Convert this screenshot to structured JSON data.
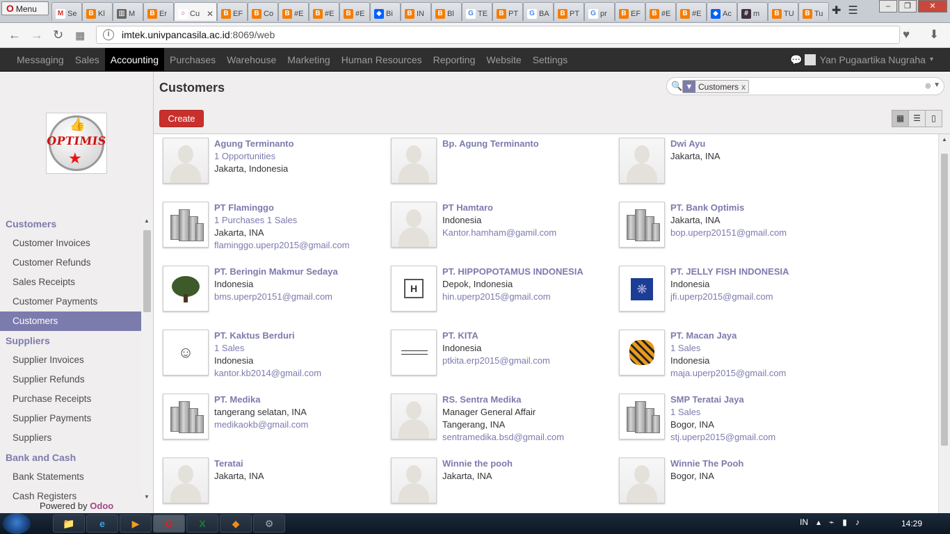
{
  "browser": {
    "menu_label": "Menu",
    "tabs": [
      {
        "label": "Se",
        "color": "#ffffff",
        "glyph": "M",
        "gcolor": "#d93025"
      },
      {
        "label": "Kl",
        "color": "#f57d00",
        "glyph": "B",
        "gcolor": "#fff"
      },
      {
        "label": "M",
        "color": "#666",
        "glyph": "▥",
        "gcolor": "#fff"
      },
      {
        "label": "Er",
        "color": "#f57d00",
        "glyph": "B",
        "gcolor": "#fff"
      },
      {
        "label": "Cu",
        "color": "#ffffff",
        "glyph": "○",
        "gcolor": "#8f3a8a"
      },
      {
        "label": "EF",
        "color": "#f57d00",
        "glyph": "B",
        "gcolor": "#fff"
      },
      {
        "label": "Co",
        "color": "#f57d00",
        "glyph": "B",
        "gcolor": "#fff"
      },
      {
        "label": "#E",
        "color": "#f57d00",
        "glyph": "B",
        "gcolor": "#fff"
      },
      {
        "label": "#E",
        "color": "#f57d00",
        "glyph": "B",
        "gcolor": "#fff"
      },
      {
        "label": "#E",
        "color": "#f57d00",
        "glyph": "B",
        "gcolor": "#fff"
      },
      {
        "label": "Bi",
        "color": "#0061fe",
        "glyph": "◆",
        "gcolor": "#fff"
      },
      {
        "label": "IN",
        "color": "#f57d00",
        "glyph": "B",
        "gcolor": "#fff"
      },
      {
        "label": "Bl",
        "color": "#f57d00",
        "glyph": "B",
        "gcolor": "#fff"
      },
      {
        "label": "TE",
        "color": "#ffffff",
        "glyph": "G",
        "gcolor": "#4285f4"
      },
      {
        "label": "PT",
        "color": "#f57d00",
        "glyph": "B",
        "gcolor": "#fff"
      },
      {
        "label": "BA",
        "color": "#ffffff",
        "glyph": "G",
        "gcolor": "#4285f4"
      },
      {
        "label": "PT",
        "color": "#f57d00",
        "glyph": "B",
        "gcolor": "#fff"
      },
      {
        "label": "pr",
        "color": "#ffffff",
        "glyph": "G",
        "gcolor": "#4285f4"
      },
      {
        "label": "EF",
        "color": "#f57d00",
        "glyph": "B",
        "gcolor": "#fff"
      },
      {
        "label": "#E",
        "color": "#f57d00",
        "glyph": "B",
        "gcolor": "#fff"
      },
      {
        "label": "#E",
        "color": "#f57d00",
        "glyph": "B",
        "gcolor": "#fff"
      },
      {
        "label": "Ac",
        "color": "#0061fe",
        "glyph": "◆",
        "gcolor": "#fff"
      },
      {
        "label": "m",
        "color": "#3e313c",
        "glyph": "#",
        "gcolor": "#fff"
      },
      {
        "label": "TU",
        "color": "#f57d00",
        "glyph": "B",
        "gcolor": "#fff"
      },
      {
        "label": "Tu",
        "color": "#f57d00",
        "glyph": "B",
        "gcolor": "#fff"
      }
    ],
    "active_tab_index": 4,
    "url_host": "imtek.univpancasila.ac.id",
    "url_rest": ":8069/web"
  },
  "topnav": {
    "items": [
      "Messaging",
      "Sales",
      "Accounting",
      "Purchases",
      "Warehouse",
      "Marketing",
      "Human Resources",
      "Reporting",
      "Website",
      "Settings"
    ],
    "active": "Accounting",
    "user_name": "Yan Pugaartika Nugraha"
  },
  "sidebar": {
    "logo_text": "OPTIMIS",
    "sections": [
      {
        "title": "Customers",
        "items": [
          "Customer Invoices",
          "Customer Refunds",
          "Sales Receipts",
          "Customer Payments",
          "Customers"
        ]
      },
      {
        "title": "Suppliers",
        "items": [
          "Supplier Invoices",
          "Supplier Refunds",
          "Purchase Receipts",
          "Supplier Payments",
          "Suppliers"
        ]
      },
      {
        "title": "Bank and Cash",
        "items": [
          "Bank Statements",
          "Cash Registers"
        ]
      }
    ],
    "active_item": "Customers",
    "powered_by": "Powered by",
    "powered_brand": "Odoo"
  },
  "control": {
    "title": "Customers",
    "create_label": "Create",
    "search_facet": "Customers"
  },
  "customers": [
    {
      "name": "Agung Terminanto",
      "img": "person",
      "lines": [
        {
          "t": "1 Opportunities",
          "k": "link"
        },
        {
          "t": "Jakarta, Indonesia",
          "k": "text"
        }
      ]
    },
    {
      "name": "Bp. Agung Terminanto",
      "img": "person",
      "lines": []
    },
    {
      "name": "Dwi Ayu",
      "img": "person",
      "lines": [
        {
          "t": "Jakarta, INA",
          "k": "text"
        }
      ]
    },
    {
      "name": "PT Flaminggo",
      "img": "building",
      "lines": [
        {
          "t": "1 Purchases 1 Sales",
          "k": "link"
        },
        {
          "t": "Jakarta, INA",
          "k": "text"
        },
        {
          "t": "flaminggo.uperp2015@gmail.com",
          "k": "email"
        }
      ]
    },
    {
      "name": "PT Hamtaro",
      "img": "person",
      "lines": [
        {
          "t": "Indonesia",
          "k": "text"
        },
        {
          "t": "Kantor.hamham@gamil.com",
          "k": "email"
        }
      ]
    },
    {
      "name": "PT. Bank Optimis",
      "img": "building",
      "lines": [
        {
          "t": "Jakarta, INA",
          "k": "text"
        },
        {
          "t": "bop.uperp20151@gmail.com",
          "k": "email"
        }
      ]
    },
    {
      "name": "PT. Beringin Makmur Sedaya",
      "img": "tree",
      "lines": [
        {
          "t": "Indonesia",
          "k": "text"
        },
        {
          "t": "bms.uperp20151@gmail.com",
          "k": "email"
        }
      ]
    },
    {
      "name": "PT. HIPPOPOTAMUS INDONESIA",
      "img": "hippo",
      "lines": [
        {
          "t": "Depok, Indonesia",
          "k": "text"
        },
        {
          "t": "hin.uperp2015@gmail.com",
          "k": "email"
        }
      ]
    },
    {
      "name": "PT. JELLY FISH INDONESIA",
      "img": "jelly",
      "lines": [
        {
          "t": "Indonesia",
          "k": "text"
        },
        {
          "t": "jfi.uperp2015@gmail.com",
          "k": "email"
        }
      ]
    },
    {
      "name": "PT. Kaktus Berduri",
      "img": "kaktus",
      "lines": [
        {
          "t": "1 Sales",
          "k": "link"
        },
        {
          "t": "Indonesia",
          "k": "text"
        },
        {
          "t": "kantor.kb2014@gmail.com",
          "k": "email"
        }
      ]
    },
    {
      "name": "PT. KITA",
      "img": "kita",
      "lines": [
        {
          "t": "Indonesia",
          "k": "text"
        },
        {
          "t": "ptkita.erp2015@gmail.com",
          "k": "email"
        }
      ]
    },
    {
      "name": "PT. Macan Jaya",
      "img": "tiger",
      "lines": [
        {
          "t": "1 Sales",
          "k": "link"
        },
        {
          "t": "Indonesia",
          "k": "text"
        },
        {
          "t": "maja.uperp2015@gmail.com",
          "k": "email"
        }
      ]
    },
    {
      "name": "PT. Medika",
      "img": "building",
      "lines": [
        {
          "t": "tangerang selatan, INA",
          "k": "text"
        },
        {
          "t": "medikaokb@gmail.com",
          "k": "email"
        }
      ]
    },
    {
      "name": "RS. Sentra Medika",
      "img": "person",
      "lines": [
        {
          "t": "Manager General Affair",
          "k": "text"
        },
        {
          "t": "Tangerang, INA",
          "k": "text"
        },
        {
          "t": "sentramedika.bsd@gmail.com",
          "k": "email"
        }
      ]
    },
    {
      "name": "SMP Teratai Jaya",
      "img": "building",
      "lines": [
        {
          "t": "1 Sales",
          "k": "link"
        },
        {
          "t": "Bogor, INA",
          "k": "text"
        },
        {
          "t": "stj.uperp2015@gmail.com",
          "k": "email"
        }
      ]
    },
    {
      "name": "Teratai",
      "img": "person",
      "lines": [
        {
          "t": "Jakarta, INA",
          "k": "text"
        }
      ]
    },
    {
      "name": "Winnie the pooh",
      "img": "person",
      "lines": [
        {
          "t": "Jakarta, INA",
          "k": "text"
        }
      ]
    },
    {
      "name": "Winnie The Pooh",
      "img": "person",
      "lines": [
        {
          "t": "Bogor, INA",
          "k": "text"
        }
      ]
    }
  ],
  "taskbar": {
    "apps": [
      "folder",
      "ie",
      "media",
      "opera",
      "excel",
      "app",
      "tool"
    ],
    "active_app": "opera",
    "lang": "IN",
    "clock": "14:29"
  }
}
